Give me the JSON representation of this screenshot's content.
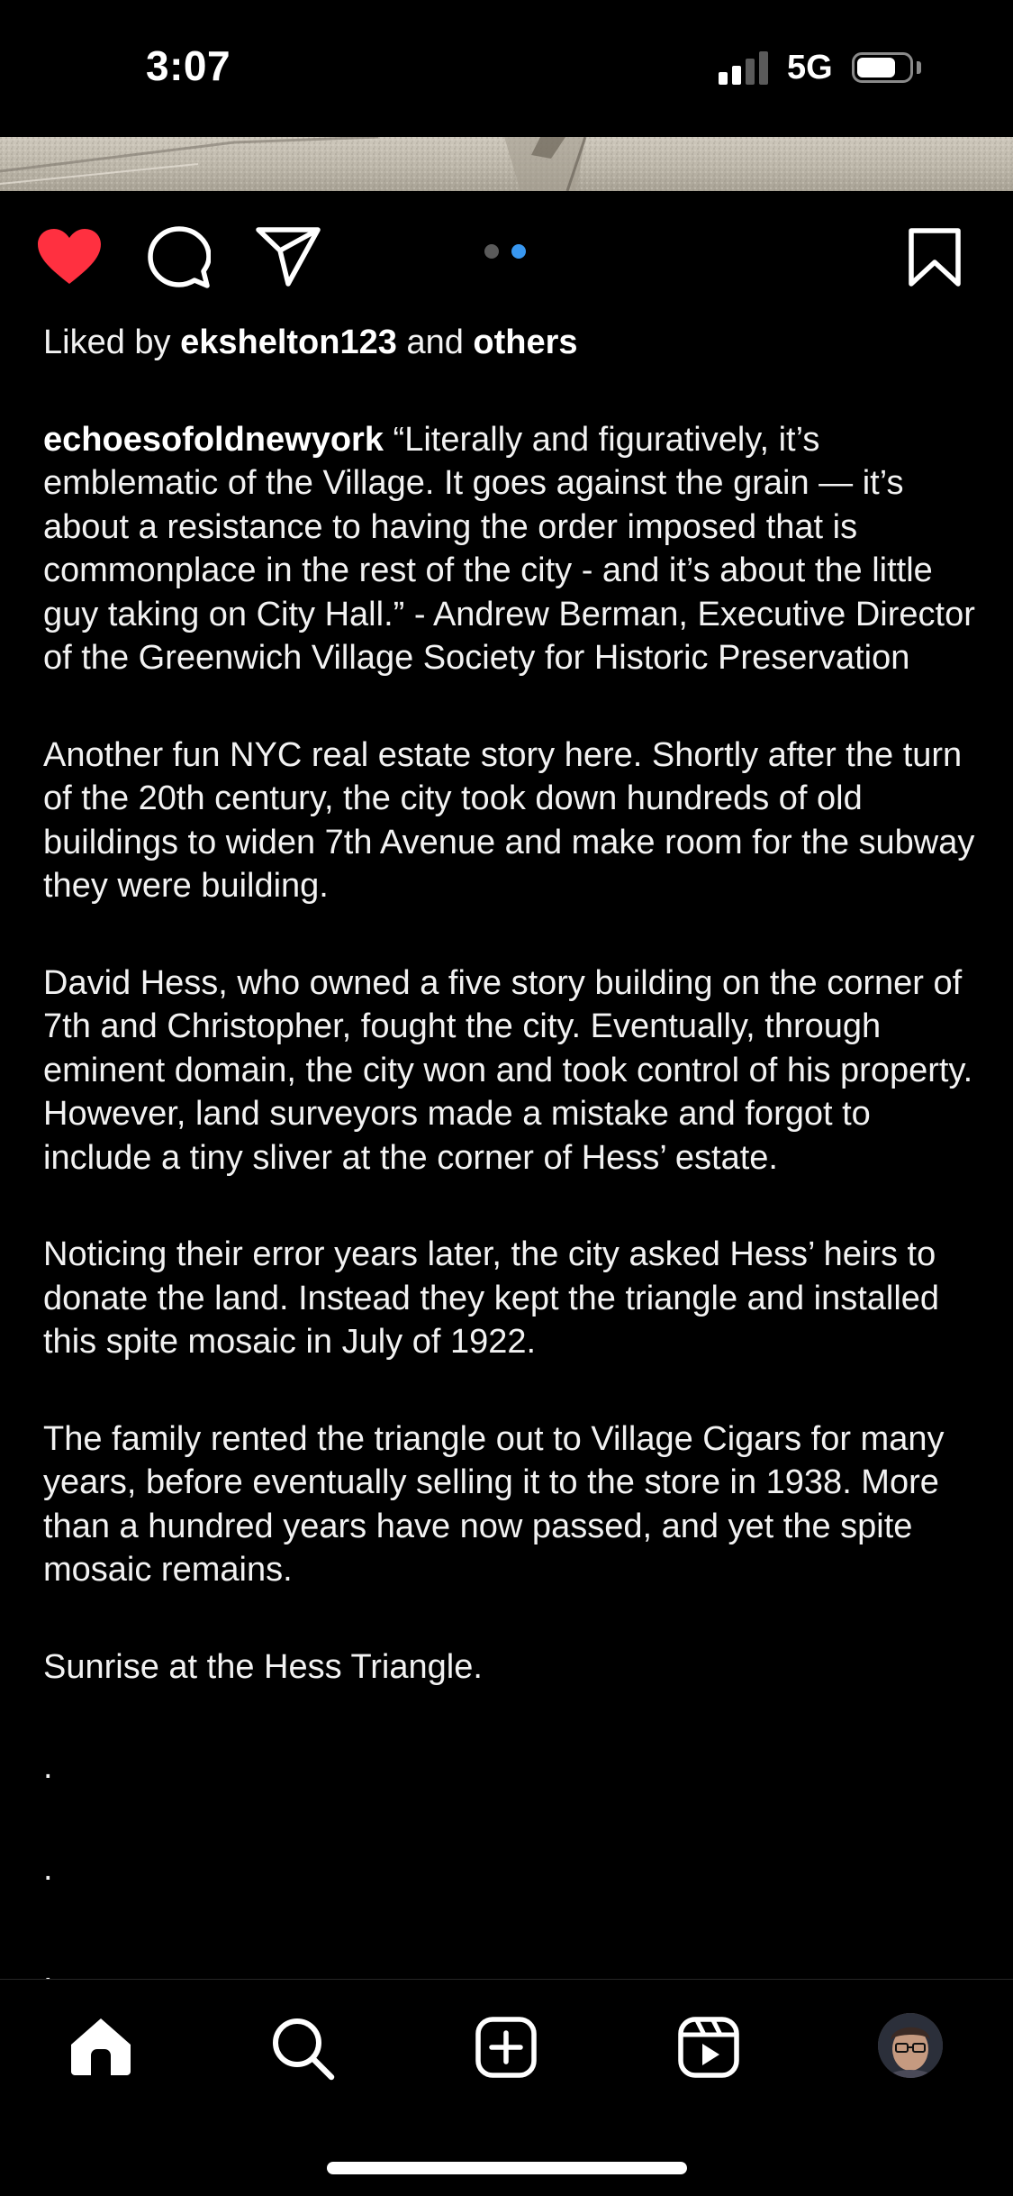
{
  "status_bar": {
    "time": "3:07",
    "network": "5G",
    "signal_bars_active": 2,
    "signal_bars_total": 4,
    "battery_level": 0.75
  },
  "post": {
    "liked_by_prefix": "Liked by ",
    "liked_by_user": "ekshelton123",
    "liked_by_and": " and ",
    "liked_by_others": "others",
    "username": "echoesofoldnewyork",
    "caption_first": " “Literally and figuratively, it’s emblematic of the Village. It goes against the grain — it’s about a resistance to having the order imposed that is commonplace in the rest of the city - and it’s about the little guy taking on City Hall.” - Andrew Berman, Executive Director of the Greenwich Village Society for Historic Preservation",
    "paragraphs": [
      "Another fun NYC real estate story here. Shortly after the turn of the 20th century, the city took down hundreds of old buildings to widen 7th Avenue and make room for the subway they were building.",
      "David Hess, who owned a five story building on the corner of 7th and Christopher, fought the city. Eventually, through eminent domain, the city won and took control of his property. However, land surveyors made a mistake and forgot to include a tiny sliver at the corner of Hess’ estate.",
      "Noticing their error years later, the city asked Hess’ heirs to donate the land. Instead they kept the triangle and installed this spite mosaic in July of 1922.",
      "The family rented the triangle out to Village Cigars for many years, before eventually selling it to the store in 1938. More than a hundred years have now passed, and yet the spite mosaic remains.",
      "Sunrise at the Hess Triangle."
    ],
    "trailing_dots": [
      ".",
      ".",
      "."
    ],
    "carousel_total": 2,
    "carousel_active": 2,
    "liked": true
  },
  "actions": {
    "like_icon": "heart-icon",
    "comment_icon": "comment-icon",
    "share_icon": "paper-plane-icon",
    "save_icon": "bookmark-icon"
  },
  "nav": {
    "items": [
      "home-icon",
      "search-icon",
      "create-icon",
      "reels-icon",
      "profile-avatar"
    ]
  },
  "colors": {
    "like_red": "#ff3040",
    "carousel_active": "#3897f0",
    "carousel_inactive": "#5a5a5a",
    "background": "#000000",
    "text": "#f2f2f2"
  }
}
